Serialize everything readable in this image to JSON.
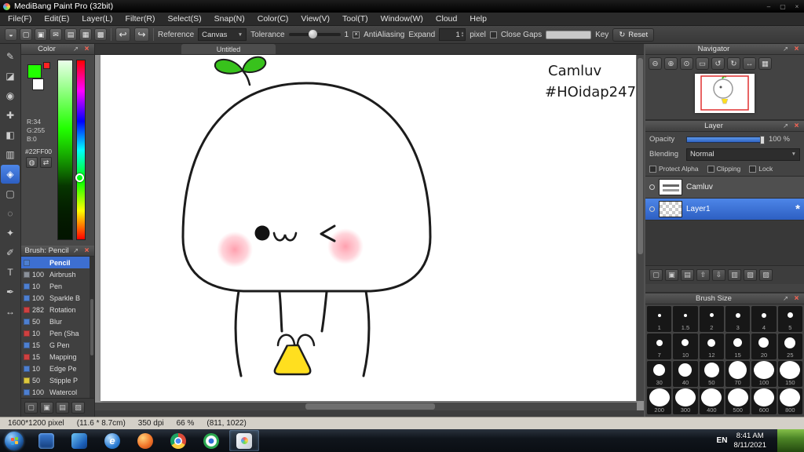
{
  "icons": {
    "popout": "↗",
    "close": "×",
    "caret": "▼",
    "check": "×",
    "up": "▴",
    "down": "▾",
    "undo": "↩",
    "redo": "↪",
    "gear": "*",
    "reset": "↻",
    "minimize": "–",
    "maximize": "▢",
    "close_window": "×"
  },
  "window": {
    "title": "MediBang Paint Pro (32bit)",
    "menu": [
      "File(F)",
      "Edit(E)",
      "Layer(L)",
      "Filter(R)",
      "Select(S)",
      "Snap(N)",
      "Color(C)",
      "View(V)",
      "Tool(T)",
      "Window(W)",
      "Cloud",
      "Help"
    ]
  },
  "toolbar": {
    "icons": [
      {
        "name": "cloud-sync-icon",
        "glyph": "◒"
      },
      {
        "name": "new-canvas-icon",
        "glyph": "▢"
      },
      {
        "name": "save-icon",
        "glyph": "▣"
      },
      {
        "name": "comment-icon",
        "glyph": "✉"
      },
      {
        "name": "snapshot-icon",
        "glyph": "▤"
      },
      {
        "name": "grid-settings-icon",
        "glyph": "▦"
      },
      {
        "name": "material-panel-icon",
        "glyph": "▩"
      }
    ],
    "reference_label": "Reference",
    "reference_value": "Canvas",
    "tolerance_label": "Tolerance",
    "tolerance_value": "1",
    "antialiasing_label": "AntiAliasing",
    "expand_label": "Expand",
    "expand_value": "1",
    "expand_unit": "pixel",
    "close_gaps_label": "Close Gaps",
    "key_label": "Key",
    "reset_label": "Reset"
  },
  "tools": [
    {
      "name": "brush-tool",
      "glyph": "✎"
    },
    {
      "name": "eraser-tool",
      "glyph": "◪"
    },
    {
      "name": "blur-tool",
      "glyph": "◉"
    },
    {
      "name": "move-tool",
      "glyph": "✚"
    },
    {
      "name": "fill-tool",
      "glyph": "◧"
    },
    {
      "name": "gradient-tool",
      "glyph": "▥"
    },
    {
      "name": "bucket-tool",
      "glyph": "◈",
      "selected": true
    },
    {
      "name": "select-tool",
      "glyph": "▢"
    },
    {
      "name": "lasso-tool",
      "glyph": "◌"
    },
    {
      "name": "magic-wand-tool",
      "glyph": "✦"
    },
    {
      "name": "select-pen-tool",
      "glyph": "✐"
    },
    {
      "name": "text-tool",
      "glyph": "T"
    },
    {
      "name": "eyedropper-tool",
      "glyph": "✒"
    },
    {
      "name": "hand-tool",
      "glyph": "↔"
    }
  ],
  "color_panel": {
    "title": "Color",
    "r": "R:34",
    "g": "G:255",
    "b": "B:0",
    "hex": "#22FF00",
    "foreground": "#22ff00",
    "sub_color": "#ff2222",
    "buttons": [
      {
        "name": "color-wheel-icon",
        "glyph": "◍"
      },
      {
        "name": "swap-color-icon",
        "glyph": "⇄"
      }
    ]
  },
  "brush_panel": {
    "title": "Brush: Pencil",
    "brushes": [
      {
        "num": "",
        "name": "Pencil",
        "color": "#4d7fd0",
        "selected": true
      },
      {
        "num": "100",
        "name": "Airbrush",
        "color": "#8a9099"
      },
      {
        "num": "10",
        "name": "Pen",
        "color": "#4d7fd0"
      },
      {
        "num": "100",
        "name": "Sparkle B",
        "color": "#4d7fd0"
      },
      {
        "num": "282",
        "name": "Rotation",
        "color": "#cf4040"
      },
      {
        "num": "50",
        "name": "Blur",
        "color": "#4d7fd0"
      },
      {
        "num": "10",
        "name": "Pen (Sha",
        "color": "#cf4040"
      },
      {
        "num": "15",
        "name": "G Pen",
        "color": "#4d7fd0"
      },
      {
        "num": "15",
        "name": "Mapping",
        "color": "#cf4040"
      },
      {
        "num": "10",
        "name": "Edge Pe",
        "color": "#4d7fd0"
      },
      {
        "num": "50",
        "name": "Stipple P",
        "color": "#ddc83d"
      },
      {
        "num": "100",
        "name": "Watercol",
        "color": "#4d7fd0"
      }
    ],
    "foot_buttons": [
      {
        "name": "add-brush-icon",
        "glyph": "▢"
      },
      {
        "name": "brush-folder-icon",
        "glyph": "▣"
      },
      {
        "name": "edit-brush-icon",
        "glyph": "▤"
      },
      {
        "name": "delete-brush-icon",
        "glyph": "▨"
      }
    ]
  },
  "canvas": {
    "tab": "Untitled",
    "signature1": "Camluv",
    "signature2": "#HOidap247"
  },
  "navigator": {
    "title": "Navigator",
    "buttons": [
      {
        "name": "zoom-out-icon",
        "glyph": "⊖"
      },
      {
        "name": "zoom-in-icon",
        "glyph": "⊕"
      },
      {
        "name": "zoom-reset-icon",
        "glyph": "⊙"
      },
      {
        "name": "fit-window-icon",
        "glyph": "▭"
      },
      {
        "name": "rotate-left-icon",
        "glyph": "↺"
      },
      {
        "name": "rotate-right-icon",
        "glyph": "↻"
      },
      {
        "name": "reset-rotation-icon",
        "glyph": "↔"
      },
      {
        "name": "pixel-grid-icon",
        "glyph": "▦"
      }
    ]
  },
  "layer_panel": {
    "title": "Layer",
    "opacity_label": "Opacity",
    "opacity_value": "100 %",
    "blending_label": "Blending",
    "blending_value": "Normal",
    "protect_alpha_label": "Protect Alpha",
    "clipping_label": "Clipping",
    "lock_label": "Lock",
    "layers": [
      {
        "name": "Camluv",
        "cls": "thumb-sig"
      },
      {
        "name": "Layer1",
        "cls": "thumb-checker",
        "selected": true
      }
    ],
    "foot_buttons": [
      {
        "name": "add-layer-icon",
        "glyph": "▢"
      },
      {
        "name": "add-folder-icon",
        "glyph": "▣"
      },
      {
        "name": "duplicate-layer-icon",
        "glyph": "▤"
      },
      {
        "name": "layer-up-icon",
        "glyph": "⇧"
      },
      {
        "name": "layer-down-icon",
        "glyph": "⇩"
      },
      {
        "name": "merge-layer-icon",
        "glyph": "▥"
      },
      {
        "name": "clear-layer-icon",
        "glyph": "▧"
      },
      {
        "name": "delete-layer-icon",
        "glyph": "▨"
      }
    ]
  },
  "brush_size_panel": {
    "title": "Brush Size",
    "sizes": [
      "1",
      "1.5",
      "2",
      "3",
      "4",
      "5",
      "7",
      "10",
      "12",
      "15",
      "20",
      "25",
      "30",
      "40",
      "50",
      "70",
      "100",
      "150",
      "200",
      "300",
      "400",
      "500",
      "600",
      "800"
    ]
  },
  "status_bar": {
    "dimensions": "1600*1200 pixel",
    "size_cm": "(11.6 * 8.7cm)",
    "dpi": "350 dpi",
    "zoom": "66 %",
    "coords": "(811, 1022)"
  },
  "taskbar": {
    "language": "EN",
    "time": "8:41 AM",
    "date": "8/11/2021",
    "apps": [
      {
        "name": "taskbar-app-media-player",
        "cls": "tb-media",
        "glyph": ""
      },
      {
        "name": "taskbar-app-windows",
        "cls": "tb-win",
        "glyph": ""
      },
      {
        "name": "taskbar-app-internet-explorer",
        "cls": "tb-ie",
        "glyph": "e"
      },
      {
        "name": "taskbar-app-firefox",
        "cls": "tb-ff",
        "glyph": ""
      },
      {
        "name": "taskbar-app-chrome",
        "cls": "tb-chrome",
        "glyph": ""
      },
      {
        "name": "taskbar-app-chrome-green",
        "cls": "tb-chrome2",
        "glyph": ""
      },
      {
        "name": "taskbar-app-medibang",
        "cls": "tb-mb",
        "glyph": "",
        "active": true
      }
    ]
  }
}
